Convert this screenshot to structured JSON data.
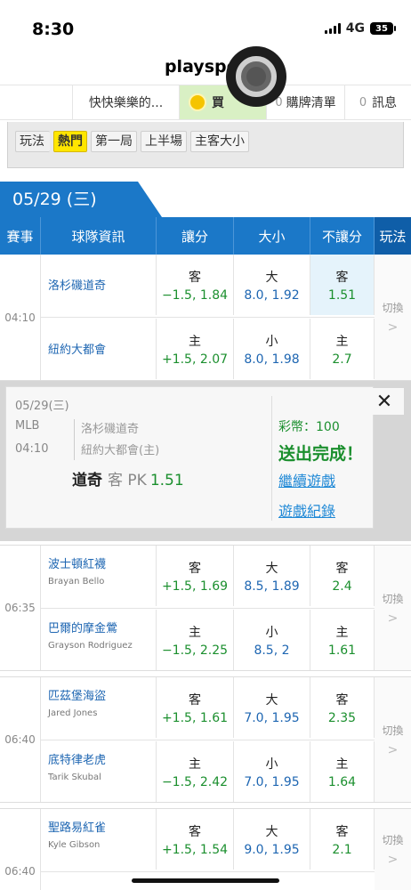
{
  "status": {
    "time": "8:30",
    "network": "4G",
    "battery": "35"
  },
  "site": {
    "title": "playspor"
  },
  "topnav": {
    "game_name": "快快樂樂的...",
    "buy_label": "買",
    "cart_count": "0",
    "cart_label": "購牌清單",
    "msg_count": "0",
    "msg_label": "訊息"
  },
  "filters": {
    "label": "玩法",
    "options": [
      "熱門",
      "第一局",
      "上半場",
      "主客大小"
    ],
    "active": "熱門"
  },
  "date": "05/29 (三)",
  "header": {
    "event": "賽事",
    "team": "球隊資訊",
    "spread": "讓分",
    "total": "大小",
    "moneyline": "不讓分",
    "play": "玩法"
  },
  "switch_label": "切換",
  "games": [
    {
      "time": "04:10",
      "away": {
        "name": "洛杉磯道奇",
        "pitcher": "",
        "spread_side": "客",
        "spread": "−1.5, 1.84",
        "ou_side": "大",
        "ou": "8.0, 1.92",
        "ml_side": "客",
        "ml": "1.51"
      },
      "home": {
        "name": "紐約大都會",
        "pitcher": "",
        "spread_side": "主",
        "spread": "+1.5, 2.07",
        "ou_side": "小",
        "ou": "8.0, 1.98",
        "ml_side": "主",
        "ml": "2.7"
      }
    },
    {
      "time": "06:35",
      "away": {
        "name": "波士頓紅襪",
        "pitcher": "Brayan Bello",
        "spread_side": "客",
        "spread": "+1.5, 1.69",
        "ou_side": "大",
        "ou": "8.5, 1.89",
        "ml_side": "客",
        "ml": "2.4"
      },
      "home": {
        "name": "巴爾的摩金鶯",
        "pitcher": "Grayson Rodriguez",
        "spread_side": "主",
        "spread": "−1.5, 2.25",
        "ou_side": "小",
        "ou": "8.5, 2",
        "ml_side": "主",
        "ml": "1.61"
      }
    },
    {
      "time": "06:40",
      "away": {
        "name": "匹茲堡海盜",
        "pitcher": "Jared Jones",
        "spread_side": "客",
        "spread": "+1.5, 1.61",
        "ou_side": "大",
        "ou": "7.0, 1.95",
        "ml_side": "客",
        "ml": "2.35"
      },
      "home": {
        "name": "底特律老虎",
        "pitcher": "Tarik Skubal",
        "spread_side": "主",
        "spread": "−1.5, 2.42",
        "ou_side": "小",
        "ou": "7.0, 1.95",
        "ml_side": "主",
        "ml": "1.64"
      }
    },
    {
      "time": "06:40",
      "away": {
        "name": "聖路易紅雀",
        "pitcher": "Kyle Gibson",
        "spread_side": "客",
        "spread": "+1.5, 1.54",
        "ou_side": "大",
        "ou": "9.0, 1.95",
        "ml_side": "客",
        "ml": "2.1"
      }
    }
  ],
  "popup": {
    "date": "05/29(三)",
    "league": "MLB",
    "time": "04:10",
    "away": "洛杉磯道奇",
    "home": "紐約大都會(主)",
    "bet_team": "道奇",
    "bet_side": "客 PK",
    "bet_odds": "1.51",
    "coins": "彩幣：100",
    "done": "送出完成！",
    "continue": "繼續遊戲",
    "history": "遊戲紀錄",
    "close": "✕"
  }
}
